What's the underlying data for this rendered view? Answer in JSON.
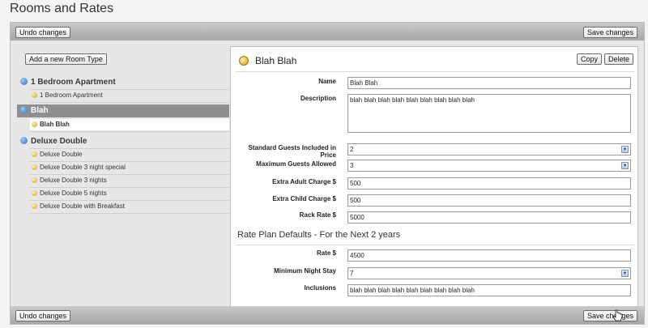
{
  "page": {
    "title": "Rooms and Rates"
  },
  "toolbar": {
    "undo_label": "Undo changes",
    "save_label": "Save changes"
  },
  "sidebar": {
    "add_label": "Add a new Room Type",
    "groups": [
      {
        "label": "1 Bedroom Apartment",
        "items": [
          "1 Bedroom Apartment"
        ]
      },
      {
        "label": "Blah",
        "items": [
          "Blah Blah"
        ]
      },
      {
        "label": "Deluxe Double",
        "items": [
          "Deluxe Double",
          "Deluxe Double 3 night special",
          "Deluxe Double 3 nights",
          "Deluxe Double 5 nights",
          "Deluxe Double with Breakfast"
        ]
      }
    ]
  },
  "editor": {
    "title": "Blah Blah",
    "copy_label": "Copy",
    "delete_label": "Delete",
    "fields": {
      "name": {
        "label": "Name",
        "value": "Blah Blah"
      },
      "description": {
        "label": "Description",
        "value": "blah blah blah blah blah blah blah blah blah"
      },
      "std_guests": {
        "label": "Standard Guests Included in Price",
        "value": "2"
      },
      "max_guests": {
        "label": "Maximum Guests Allowed",
        "value": "3"
      },
      "adult_charge": {
        "label": "Extra Adult Charge $",
        "value": "500"
      },
      "child_charge": {
        "label": "Extra Child Charge $",
        "value": "500"
      },
      "rack_rate": {
        "label": "Rack Rate $",
        "value": "5000"
      }
    },
    "section_title": "Rate Plan Defaults - For the Next 2 years",
    "rate_fields": {
      "rate": {
        "label": "Rate $",
        "value": "4500"
      },
      "min_stay": {
        "label": "Minimum Night Stay",
        "value": "7"
      },
      "inclusions": {
        "label": "Inclusions",
        "value": "blah blah blah blah blah blah blah blah blah"
      }
    }
  },
  "icons": {
    "select_arrow": "chevron-down-icon",
    "room_item": "coin-icon",
    "group_toggle": "collapse-icon",
    "pointer": "hand-cursor-icon"
  }
}
